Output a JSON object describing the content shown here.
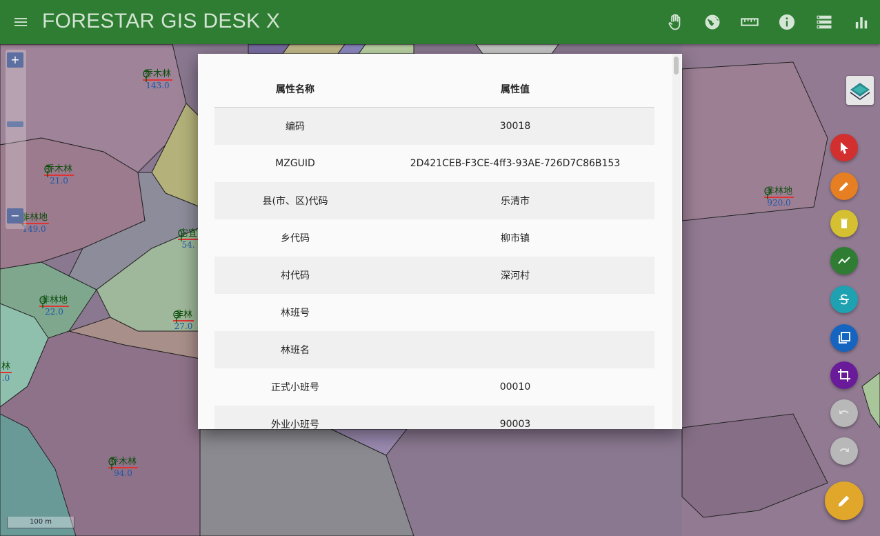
{
  "app": {
    "title": "FORESTAR GIS DESK X"
  },
  "toolbar": {
    "icons": [
      "pan-hand-icon",
      "globe-icon",
      "ruler-icon",
      "info-icon",
      "layer-list-icon",
      "bar-chart-icon"
    ]
  },
  "map": {
    "scale_label": "100 m",
    "labels": [
      {
        "name": "乔木林",
        "value": "143.0"
      },
      {
        "name": "乔木林",
        "value": "21.0"
      },
      {
        "name": "非林地",
        "value": "149.0"
      },
      {
        "name": "它宜",
        "value": "54."
      },
      {
        "name": "非林地",
        "value": "22.0"
      },
      {
        "name": "非林",
        "value": "27.0"
      },
      {
        "name": "林",
        "value": ".0"
      },
      {
        "name": "乔木林",
        "value": "94.0"
      },
      {
        "name": "非林地",
        "value": "920.0"
      }
    ]
  },
  "zoom": {
    "in_label": "+",
    "out_label": "−"
  },
  "fabs": {
    "colors": {
      "select": "#d32f2f",
      "edit": "#e67e22",
      "delete": "#d4c031",
      "line": "#2e7d32",
      "split": "#1ea1b0",
      "copy": "#1565c0",
      "crop": "#6a1b9a",
      "undo": "#b8b8b8",
      "redo": "#b8b8b8",
      "main": "#e0a72a"
    }
  },
  "dialog": {
    "headers": {
      "name": "属性名称",
      "value": "属性值"
    },
    "rows": [
      {
        "name": "编码",
        "value": "30018"
      },
      {
        "name": "MZGUID",
        "value": "2D421CEB-F3CE-4ff3-93AE-726D7C86B153"
      },
      {
        "name": "县(市、区)代码",
        "value": "乐清市"
      },
      {
        "name": "乡代码",
        "value": "柳市镇"
      },
      {
        "name": "村代码",
        "value": "深河村"
      },
      {
        "name": "林班号",
        "value": ""
      },
      {
        "name": "林班名",
        "value": ""
      },
      {
        "name": "正式小班号",
        "value": "00010"
      },
      {
        "name": "外业小班号",
        "value": "90003"
      }
    ]
  }
}
